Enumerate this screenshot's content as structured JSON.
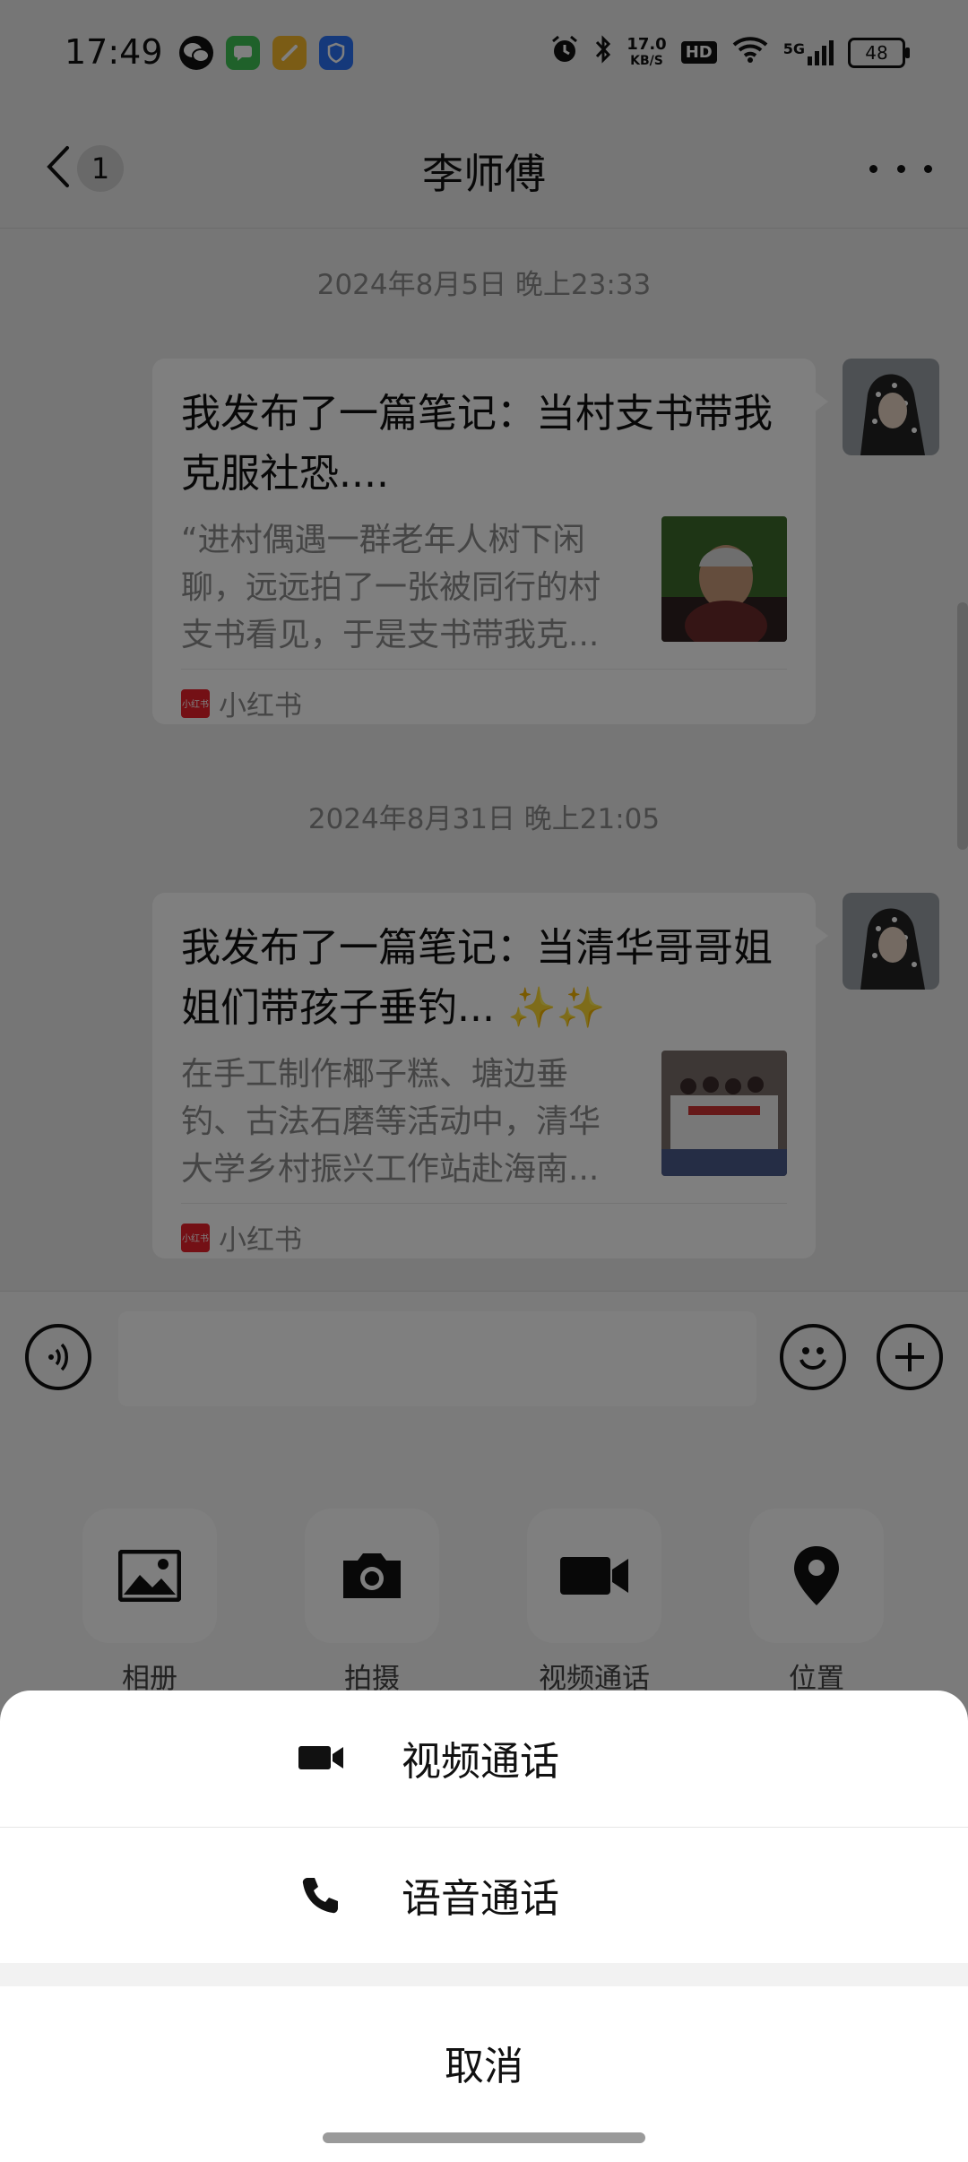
{
  "status_bar": {
    "time": "17:49",
    "net_speed_value": "17.0",
    "net_speed_unit": "KB/S",
    "hd_label": "HD",
    "signal_label": "5G",
    "battery": "48",
    "icons": [
      "wechat-icon",
      "messages-icon",
      "notes-icon",
      "security-icon",
      "alarm-icon",
      "bluetooth-icon",
      "hd-icon",
      "wifi-icon",
      "signal-icon",
      "battery-icon"
    ]
  },
  "nav": {
    "title": "李师傅",
    "unread_count": "1"
  },
  "messages": [
    {
      "timestamp": "2024年8月5日 晚上23:33",
      "title": "我发布了一篇笔记：当村支书带我克服社恐....",
      "description": "“进村偶遇一群老年人树下闲聊，远远拍了一张被同行的村支书看见，于是支书带我克...",
      "source": "小红书"
    },
    {
      "timestamp": "2024年8月31日 晚上21:05",
      "title": "我发布了一篇笔记：当清华哥哥姐姐们带孩子垂钓... ✨✨",
      "description": "在手工制作椰子糕、塘边垂钓、古法石磨等活动中，清华大学乡村振兴工作站赴海南...",
      "source": "小红书"
    }
  ],
  "source_logo_text": "小红书",
  "tools": [
    {
      "label": "相册",
      "icon": "photo-album-icon"
    },
    {
      "label": "拍摄",
      "icon": "camera-icon"
    },
    {
      "label": "视频通话",
      "icon": "video-call-icon"
    },
    {
      "label": "位置",
      "icon": "location-icon"
    }
  ],
  "action_sheet": {
    "video_call": "视频通话",
    "voice_call": "语音通话",
    "cancel": "取消"
  },
  "colors": {
    "overlay": "rgba(0,0,0,0.5)",
    "xhs_red": "#e8202a",
    "chat_bg": "#ededed"
  }
}
